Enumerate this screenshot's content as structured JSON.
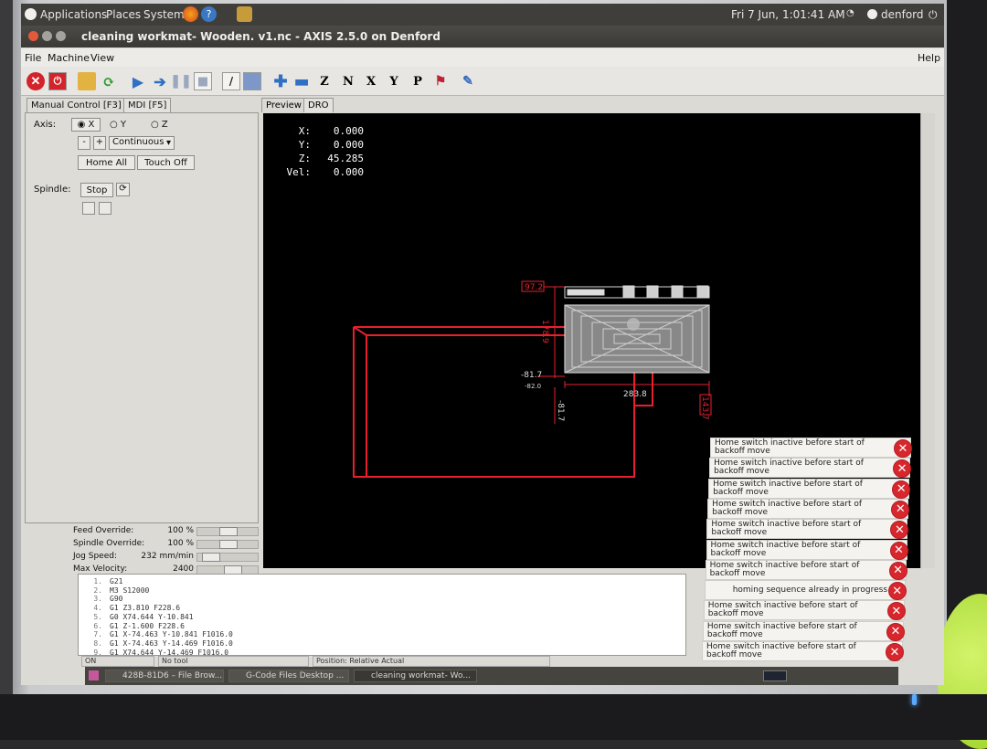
{
  "top_panel": {
    "menus": [
      "Applications",
      "Places",
      "System"
    ],
    "datetime": "Fri  7 Jun,  1:01:41 AM",
    "user": "denford"
  },
  "window": {
    "title": "cleaning workmat- Wooden. v1.nc - AXIS 2.5.0 on Denford"
  },
  "menubar": {
    "items": [
      "File",
      "Machine",
      "View"
    ],
    "help": "Help"
  },
  "toolbar": {
    "letter_buttons": [
      "Z",
      "N",
      "X",
      "Y",
      "P"
    ]
  },
  "left_panel": {
    "tabs": [
      "Manual Control [F3]",
      "MDI [F5]"
    ],
    "axis_label": "Axis:",
    "axes": [
      "X",
      "Y",
      "Z"
    ],
    "selected_axis": "X",
    "jog_minus": "-",
    "jog_plus": "+",
    "jog_mode": "Continuous",
    "home_all": "Home All",
    "touch_off": "Touch Off",
    "spindle_label": "Spindle:",
    "spindle_stop": "Stop",
    "overrides": [
      {
        "label": "Feed Override:",
        "value": "100 %",
        "level": 0.5
      },
      {
        "label": "Spindle Override:",
        "value": "100 %",
        "level": 0.5
      },
      {
        "label": "Jog Speed:",
        "value": "232 mm/min",
        "level": 0.1
      },
      {
        "label": "Max Velocity:",
        "value": "2400 mm/min",
        "level": 0.6
      }
    ]
  },
  "preview": {
    "tabs": [
      "Preview",
      "DRO"
    ],
    "dro": [
      {
        "axis": "X:",
        "value": "0.000"
      },
      {
        "axis": "Y:",
        "value": "0.000"
      },
      {
        "axis": "Z:",
        "value": "45.285"
      },
      {
        "axis": "Vel:",
        "value": "0.000"
      }
    ],
    "dims": {
      "top": "97.2",
      "y_extent": "178.9",
      "left": "-81.7",
      "left_small": "-82.0",
      "bottom": "-81.7",
      "x_extent": "283.8",
      "right": "143.7"
    }
  },
  "gcode": {
    "lines": [
      {
        "n": "1.",
        "code": "G21"
      },
      {
        "n": "2.",
        "code": "M3 S12000"
      },
      {
        "n": "3.",
        "code": "G90"
      },
      {
        "n": "4.",
        "code": "G1 Z3.810 F228.6"
      },
      {
        "n": "5.",
        "code": "G0 X74.644 Y-10.841"
      },
      {
        "n": "6.",
        "code": "G1 Z-1.600 F228.6"
      },
      {
        "n": "7.",
        "code": "G1 X-74.463 Y-10.841 F1016.0"
      },
      {
        "n": "8.",
        "code": "G1 X-74.463 Y-14.469 F1016.0"
      },
      {
        "n": "9.",
        "code": "G1 X74.644 Y-14.469 F1016.0"
      }
    ]
  },
  "status_bar": {
    "state": "ON",
    "tool": "No tool",
    "position": "Position: Relative Actual"
  },
  "taskbar": {
    "tasks": [
      "428B-81D6 – File Brow...",
      "G-Code Files Desktop ...",
      "cleaning workmat- Wo..."
    ]
  },
  "notifications": [
    "Home switch inactive before start of backoff move",
    "Home switch inactive before start of backoff move",
    "Home switch inactive before start of backoff move",
    "Home switch inactive before start of backoff move",
    "Home switch inactive before start of backoff move",
    "Home switch inactive before start of backoff move",
    "Home switch inactive before start of backoff move",
    "homing sequence already in progress",
    "Home switch inactive before start of backoff move",
    "Home switch inactive before start of backoff move",
    "Home switch inactive before start of backoff move"
  ],
  "colors": {
    "toolpath": "#e8202e",
    "notification_x": "#d8262d",
    "preview_bg": "#000000"
  }
}
